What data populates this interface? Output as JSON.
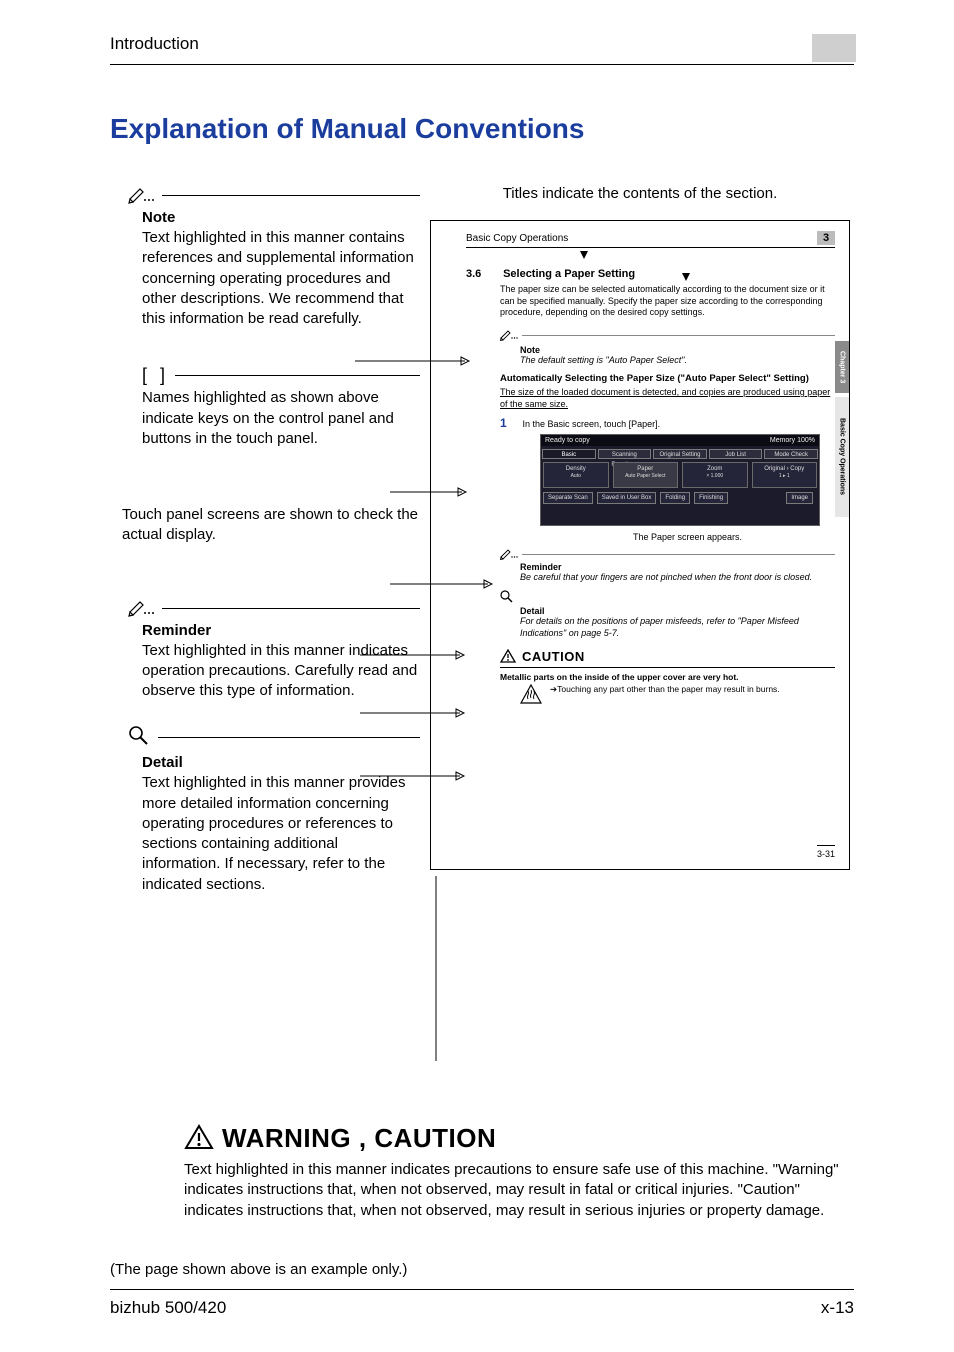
{
  "running_head": "Introduction",
  "title": "Explanation of Manual Conventions",
  "left": {
    "note": {
      "heading": "Note",
      "body": "Text highlighted in this manner contains references and supplemental information concerning operating procedures and other descriptions. We recommend that this information be read carefully."
    },
    "brackets": {
      "symbol": "[   ]",
      "body": "Names highlighted as shown above indicate keys on the control panel and buttons in the touch panel."
    },
    "touchpanel": {
      "body": "Touch panel screens are shown to check the actual display."
    },
    "reminder": {
      "heading": "Reminder",
      "body": "Text highlighted in this manner indicates operation precautions. Carefully read and observe this type of information."
    },
    "detail": {
      "heading": "Detail",
      "body": "Text highlighted in this manner provides more detailed information concerning operating procedures or references to sections containing additional information. If necessary, refer to the indicated sections."
    }
  },
  "right": {
    "titles_caption": "Titles indicate the contents of the section.",
    "head": "Basic Copy Operations",
    "chapnum": "3",
    "sec_num": "3.6",
    "sec_title": "Selecting a Paper Setting",
    "sec_body": "The paper size can be selected automatically according to the document size or it can be specified manually. Specify the paper size according to the corresponding procedure, depending on the desired copy settings.",
    "note_h": "Note",
    "note_i": "The default setting is \"Auto Paper Select\".",
    "sub_head": "Automatically Selecting the Paper Size (\"Auto Paper Select\" Setting)",
    "sub_body": "The size of the loaded document is detected, and copies are produced using paper of the same size.",
    "step1_n": "1",
    "step1": "In the Basic screen, touch [Paper].",
    "after_panel": "The Paper screen appears.",
    "reminder_h": "Reminder",
    "reminder_i": "Be careful that your fingers are not pinched when the front door is closed.",
    "detail_h": "Detail",
    "detail_i": "For details on the positions of paper misfeeds, refer to \"Paper Misfeed Indications\" on page 5-7.",
    "caution_lbl": "CAUTION",
    "caution_body": "Metallic parts on the inside of the upper cover are very hot.",
    "caution_arrow": "➔Touching any part other than the paper may result in burns.",
    "pagenum": "3-31",
    "sidebar1": "Chapter 3",
    "sidebar2": "Basic Copy Operations",
    "panel": {
      "title_left": "Ready to copy",
      "title_right": "Memory  100%",
      "tabs": [
        "Basic",
        "Scanning Functions",
        "Original Setting",
        "Job List",
        "Mode Check"
      ],
      "cells_h": [
        "Density",
        "Paper",
        "Zoom",
        "Original › Copy"
      ],
      "cells_v": [
        "Auto",
        "Auto Paper Select",
        "× 1.000",
        "1 ▸ 1"
      ],
      "lower": [
        "Separate Scan",
        "Saved in User Box",
        "Folding",
        "Finishing"
      ],
      "image_btn": "Image"
    }
  },
  "warning": {
    "label": "WARNING , CAUTION",
    "body": "Text highlighted in this manner indicates precautions to ensure safe use of this machine. \"Warning\" indicates instructions that, when not observed, may result in fatal or critical injuries. \"Caution\" indicates instructions that, when not observed, may result in serious injuries or property damage."
  },
  "example_note": "(The page shown above is an example only.)",
  "footer_left": "bizhub 500/420",
  "footer_right": "x-13"
}
